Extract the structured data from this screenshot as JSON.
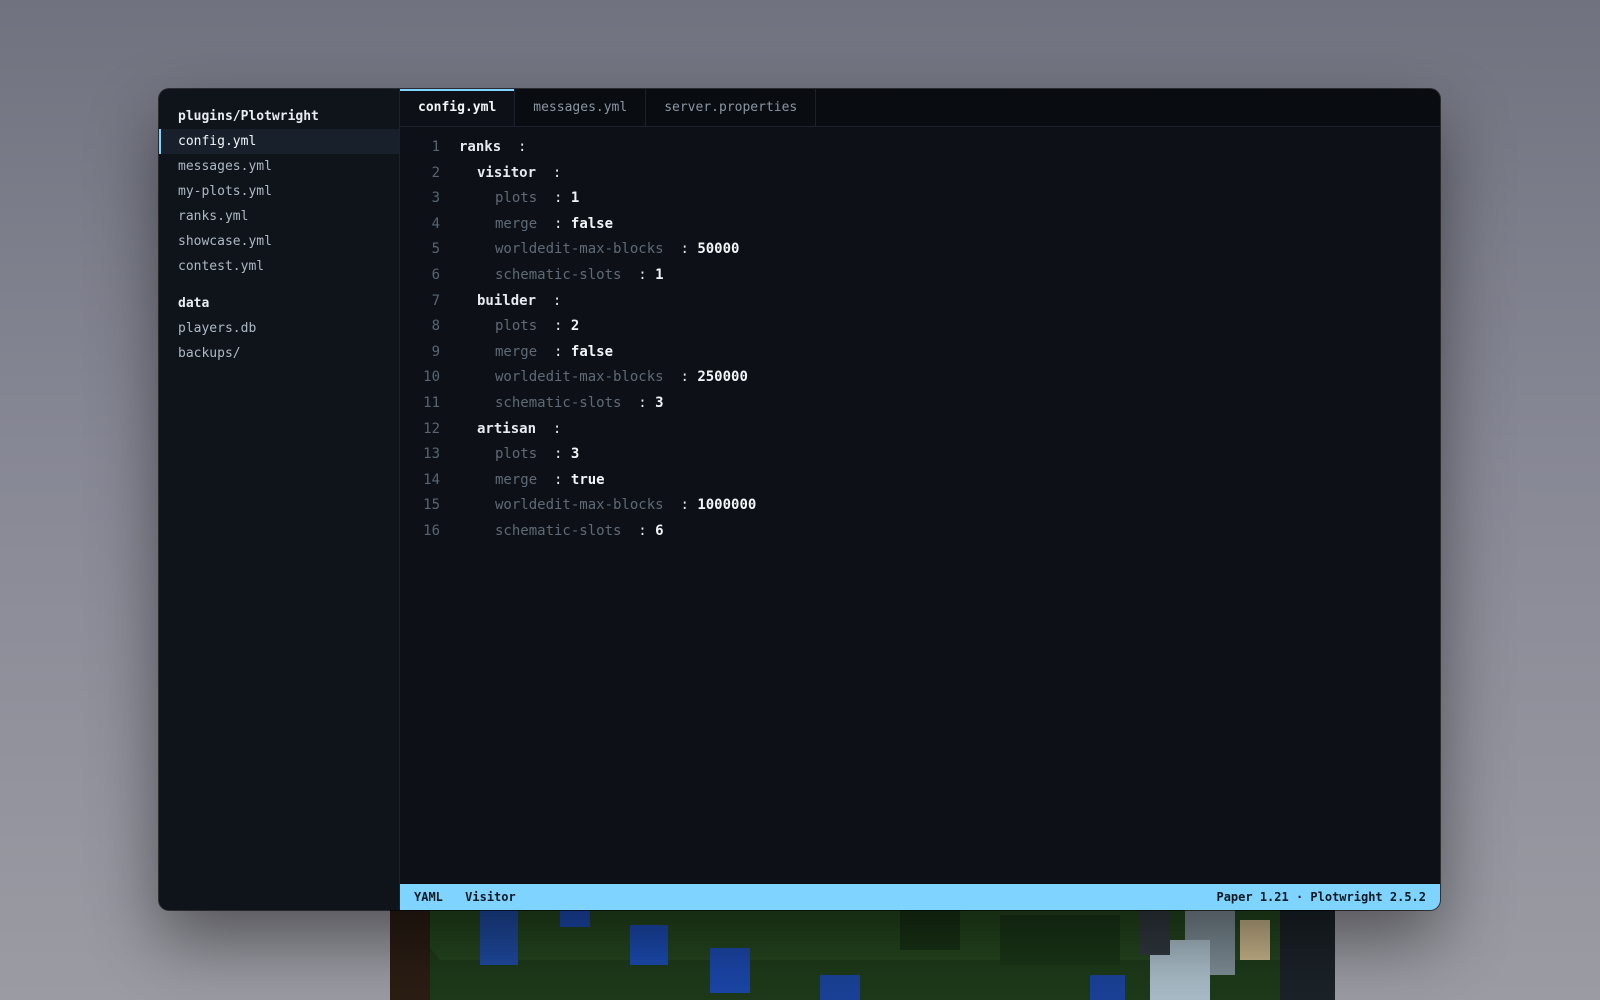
{
  "sidebar": {
    "groups": [
      {
        "title": "plugins/Plotwright",
        "items": [
          "config.yml",
          "messages.yml",
          "my-plots.yml",
          "ranks.yml",
          "showcase.yml",
          "contest.yml"
        ]
      },
      {
        "title": "data",
        "items": [
          "players.db",
          "backups/"
        ]
      }
    ]
  },
  "tabs": [
    "config.yml",
    "messages.yml",
    "server.properties"
  ],
  "editor": {
    "separator": ":",
    "lines": [
      {
        "n": "1",
        "key": "ranks",
        "value": ""
      },
      {
        "n": "2",
        "key": "visitor",
        "value": ""
      },
      {
        "n": "3",
        "key": "plots",
        "value": "1"
      },
      {
        "n": "4",
        "key": "merge",
        "value": "false"
      },
      {
        "n": "5",
        "key": "worldedit-max-blocks",
        "value": "50000"
      },
      {
        "n": "6",
        "key": "schematic-slots",
        "value": "1"
      },
      {
        "n": "7",
        "key": "builder",
        "value": ""
      },
      {
        "n": "8",
        "key": "plots",
        "value": "2"
      },
      {
        "n": "9",
        "key": "merge",
        "value": "false"
      },
      {
        "n": "10",
        "key": "worldedit-max-blocks",
        "value": "250000"
      },
      {
        "n": "11",
        "key": "schematic-slots",
        "value": "3"
      },
      {
        "n": "12",
        "key": "artisan",
        "value": ""
      },
      {
        "n": "13",
        "key": "plots",
        "value": "3"
      },
      {
        "n": "14",
        "key": "merge",
        "value": "true"
      },
      {
        "n": "15",
        "key": "worldedit-max-blocks",
        "value": "1000000"
      },
      {
        "n": "16",
        "key": "schematic-slots",
        "value": "6"
      }
    ]
  },
  "status": {
    "language": "YAML",
    "context": "Visitor",
    "version": "Paper 1.21 · Plotwright 2.5.2"
  },
  "colors": {
    "accent": "#7fd4ff",
    "editor_bg": "#0d1117",
    "sidebar_bg": "#0f141b"
  }
}
